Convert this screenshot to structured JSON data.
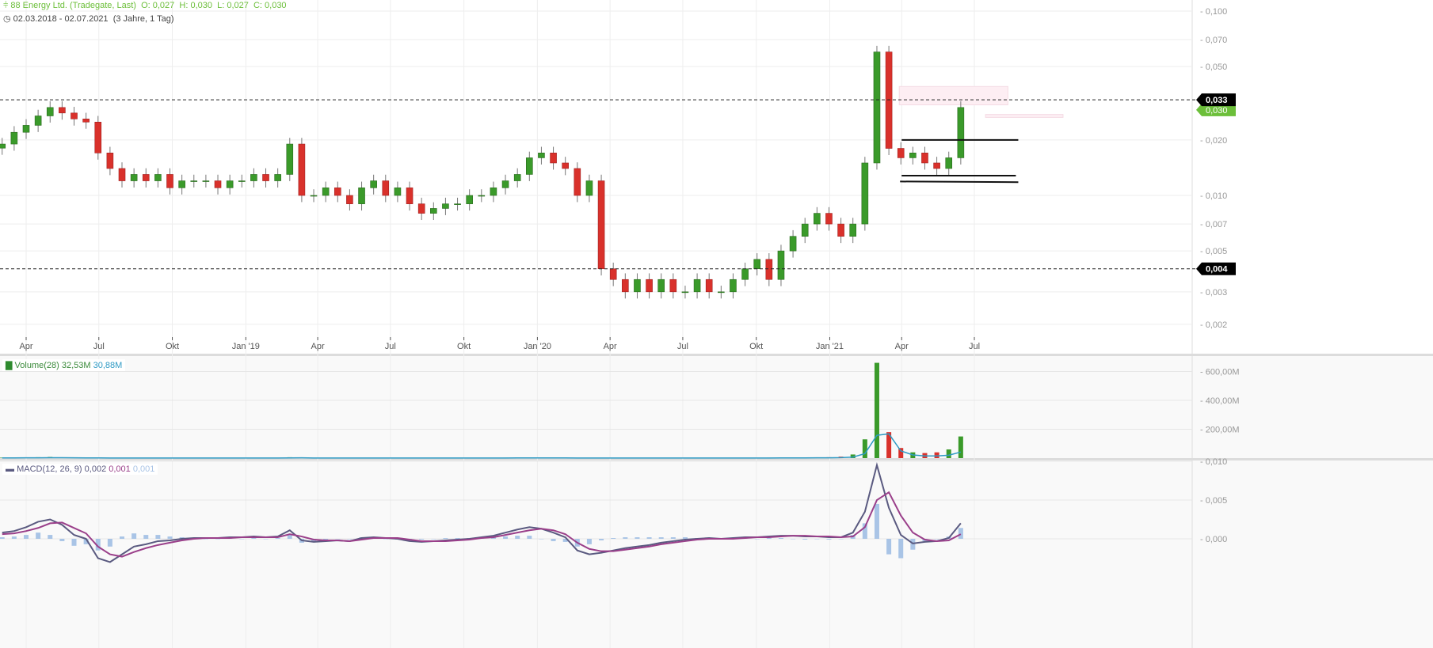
{
  "header": {
    "instrument": "88 Energy Ltd. (Tradegate, Last)",
    "ohlc": "O: 0,027  H: 0,030  L: 0,027  C: 0,030",
    "range": "02.03.2018 - 02.07.2021",
    "range_detail": "(3 Jahre, 1 Tag)"
  },
  "volume_legend": {
    "label": "Volume(28)",
    "value": "32,53M",
    "ma_value": "30,88M"
  },
  "macd_legend": {
    "label": "MACD(12, 26, 9)",
    "macd": "0,002",
    "signal": "0,001",
    "hist": "0,001"
  },
  "colors": {
    "up": "#3a9a2a",
    "down": "#d9312b",
    "accent": "#6cbf3a",
    "vol_ma": "#2e9ac4",
    "macd": "#5a5a80",
    "signal": "#9a3f8a",
    "hist": "#a9c4e6"
  },
  "chart_data": {
    "type": "candlestick",
    "title": "88 Energy Ltd. (Tradegate, Last)",
    "y_scale": "log",
    "ylim": [
      0.0017,
      0.11
    ],
    "price_ticks": [
      "0,100",
      "0,070",
      "0,050",
      "0,020",
      "0,010",
      "0,007",
      "0,005",
      "0,003",
      "0,002"
    ],
    "price_tick_values": [
      0.1,
      0.07,
      0.05,
      0.02,
      0.01,
      0.007,
      0.005,
      0.003,
      0.002
    ],
    "x_ticks": [
      {
        "label": "Apr",
        "date": "2018-04-01"
      },
      {
        "label": "Jul",
        "date": "2018-07-01"
      },
      {
        "label": "Okt",
        "date": "2018-10-01"
      },
      {
        "label": "Jan '19",
        "date": "2019-01-01"
      },
      {
        "label": "Apr",
        "date": "2019-04-01"
      },
      {
        "label": "Jul",
        "date": "2019-07-01"
      },
      {
        "label": "Okt",
        "date": "2019-10-01"
      },
      {
        "label": "Jan '20",
        "date": "2020-01-01"
      },
      {
        "label": "Apr",
        "date": "2020-04-01"
      },
      {
        "label": "Jul",
        "date": "2020-07-01"
      },
      {
        "label": "Okt",
        "date": "2020-10-01"
      },
      {
        "label": "Jan '21",
        "date": "2021-01-01"
      },
      {
        "label": "Apr",
        "date": "2021-04-01"
      },
      {
        "label": "Jul",
        "date": "2021-07-01"
      }
    ],
    "start_date": "2018-03-02",
    "step_days": 15,
    "closes": [
      0.019,
      0.022,
      0.024,
      0.027,
      0.03,
      0.028,
      0.026,
      0.025,
      0.017,
      0.014,
      0.012,
      0.013,
      0.012,
      0.013,
      0.011,
      0.012,
      0.012,
      0.012,
      0.011,
      0.012,
      0.012,
      0.013,
      0.012,
      0.013,
      0.019,
      0.01,
      0.01,
      0.011,
      0.01,
      0.009,
      0.011,
      0.012,
      0.01,
      0.011,
      0.009,
      0.008,
      0.0085,
      0.009,
      0.009,
      0.01,
      0.01,
      0.011,
      0.012,
      0.013,
      0.016,
      0.017,
      0.015,
      0.014,
      0.01,
      0.012,
      0.004,
      0.0035,
      0.003,
      0.0035,
      0.003,
      0.0035,
      0.003,
      0.003,
      0.0035,
      0.003,
      0.003,
      0.0035,
      0.004,
      0.0045,
      0.0035,
      0.005,
      0.006,
      0.007,
      0.008,
      0.007,
      0.006,
      0.007,
      0.015,
      0.06,
      0.018,
      0.016,
      0.017,
      0.015,
      0.014,
      0.016,
      0.03
    ],
    "volume_m": [
      3,
      4,
      5,
      6,
      8,
      5,
      4,
      3,
      3,
      2,
      2,
      2,
      2,
      2,
      2,
      2,
      2,
      2,
      2,
      2,
      2,
      2,
      2,
      2,
      6,
      3,
      2,
      2,
      2,
      2,
      2,
      2,
      2,
      2,
      2,
      2,
      2,
      2,
      2,
      2,
      2,
      2,
      3,
      4,
      4,
      3,
      3,
      3,
      2,
      1,
      1,
      1,
      1,
      1,
      1,
      1,
      1,
      1,
      1,
      1,
      2,
      2,
      2,
      2,
      3,
      3,
      4,
      4,
      5,
      6,
      10,
      25,
      130,
      660,
      180,
      70,
      40,
      35,
      40,
      60,
      150
    ],
    "volume_ticks": [
      "600,00M",
      "400,00M",
      "200,00M"
    ],
    "volume_tick_values": [
      600,
      400,
      200
    ],
    "macd": [
      0.0008,
      0.001,
      0.0015,
      0.0022,
      0.0025,
      0.0018,
      0.0005,
      0.0,
      -0.0025,
      -0.003,
      -0.002,
      -0.001,
      -0.0007,
      -0.0003,
      -0.0002,
      0,
      0.0001,
      0.0001,
      0.0001,
      0.0002,
      0.0002,
      0.0003,
      0.0002,
      0.0003,
      0.0011,
      -0.0002,
      -0.0004,
      -0.0003,
      -0.0002,
      -0.0003,
      0.0001,
      0.0002,
      0.0001,
      0,
      -0.0003,
      -0.0004,
      -0.0003,
      -0.0002,
      -0.0001,
      0,
      0.0002,
      0.0004,
      0.0008,
      0.0012,
      0.0015,
      0.0013,
      0.0008,
      0.0002,
      -0.0015,
      -0.002,
      -0.0018,
      -0.0015,
      -0.0012,
      -0.001,
      -0.0008,
      -0.0005,
      -0.0003,
      -0.0001,
      0,
      0.0001,
      0,
      0.0001,
      0.0002,
      0.0002,
      0.0003,
      0.0004,
      0.0004,
      0.0003,
      0.0003,
      0.0002,
      0.0002,
      0.0008,
      0.0035,
      0.0095,
      0.004,
      0.0005,
      -0.0006,
      -0.0004,
      -0.0003,
      0.0001,
      0.002
    ],
    "signal": [
      0.0006,
      0.0007,
      0.001,
      0.0014,
      0.002,
      0.0021,
      0.0014,
      0.0007,
      -0.001,
      -0.002,
      -0.0023,
      -0.0017,
      -0.0012,
      -0.0008,
      -0.0005,
      -0.0002,
      0,
      0.0001,
      0.0001,
      0.0001,
      0.0002,
      0.0002,
      0.0002,
      0.0002,
      0.0006,
      0.0003,
      -0.0001,
      -0.0002,
      -0.0002,
      -0.0003,
      -0.0001,
      0.0001,
      0.0001,
      0.0001,
      -0.0001,
      -0.0003,
      -0.0003,
      -0.0003,
      -0.0002,
      -0.0001,
      0.0001,
      0.0002,
      0.0005,
      0.0008,
      0.0011,
      0.0013,
      0.0011,
      0.0006,
      -0.0005,
      -0.0013,
      -0.0016,
      -0.0016,
      -0.0014,
      -0.0012,
      -0.001,
      -0.0007,
      -0.0005,
      -0.0003,
      -0.0001,
      0,
      0,
      0,
      0.0001,
      0.0002,
      0.0002,
      0.0003,
      0.0004,
      0.0004,
      0.0003,
      0.0003,
      0.0002,
      0.0003,
      0.0015,
      0.005,
      0.006,
      0.003,
      0.0008,
      -0.0001,
      -0.0003,
      -0.0002,
      0.0006
    ],
    "macd_ticks": [
      "0,010",
      "0,005",
      "0,000"
    ],
    "macd_tick_values": [
      0.01,
      0.005,
      0.0
    ],
    "horizontal_lines": [
      {
        "value": 0.033,
        "label": "0,033"
      },
      {
        "value": 0.004,
        "label": "0,004"
      }
    ],
    "last_price": {
      "value": 0.03,
      "label": "0,030"
    },
    "zones": [
      {
        "from_date": "2021-03-29",
        "to_date": "2021-08-12",
        "low": 0.031,
        "high": 0.039
      },
      {
        "from_date": "2021-07-15",
        "to_date": "2021-10-20",
        "low": 0.0265,
        "high": 0.0275
      }
    ],
    "trendlines": [
      {
        "from_date": "2021-04-01",
        "to_date": "2021-08-25",
        "from": 0.02,
        "to": 0.02
      },
      {
        "from_date": "2021-04-01",
        "to_date": "2021-08-22",
        "from": 0.0128,
        "to": 0.0128
      },
      {
        "from_date": "2021-03-30",
        "to_date": "2021-08-25",
        "from": 0.0119,
        "to": 0.0118
      }
    ]
  }
}
